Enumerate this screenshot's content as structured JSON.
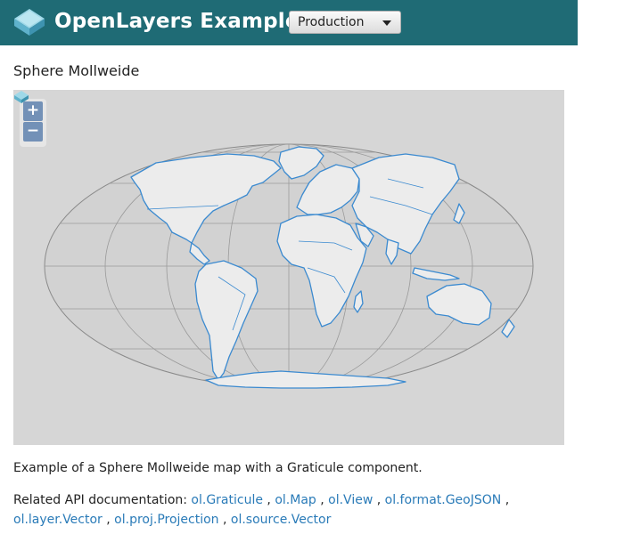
{
  "header": {
    "brand": "OpenLayers Examples",
    "version_select": {
      "value": "Production"
    },
    "logo_icon": "openlayers-logo-icon"
  },
  "page_title": "Sphere Mollweide",
  "map": {
    "projection": "Mollweide",
    "controls": {
      "zoom_in": "+",
      "zoom_out": "−"
    },
    "graticule": true,
    "land_stroke_color": "#3b8ad0",
    "land_fill_color": "#ececec",
    "background_color": "#d6d6d6",
    "graticule_color": "#9a9a9a"
  },
  "description": "Example of a Sphere Mollweide map with a Graticule component.",
  "api": {
    "label": "Related API documentation:",
    "links": [
      "ol.Graticule",
      "ol.Map",
      "ol.View",
      "ol.format.GeoJSON",
      "ol.layer.Vector",
      "ol.proj.Projection",
      "ol.source.Vector"
    ]
  }
}
